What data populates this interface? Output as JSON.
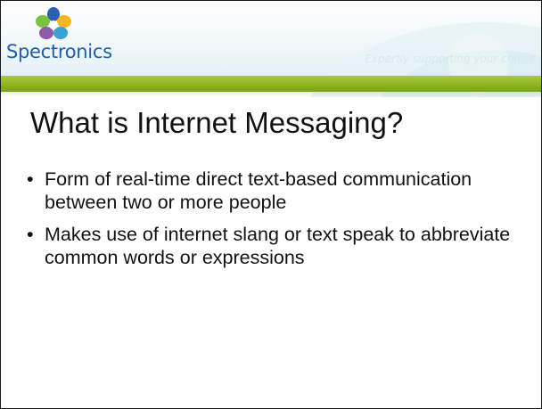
{
  "header": {
    "logo_text": "Spectronics",
    "tagline": "Expertly supporting your choice",
    "colors": {
      "accent_green": "#8db51f",
      "brand_blue": "#1f5fa8"
    }
  },
  "slide": {
    "title": "What is Internet Messaging?",
    "bullets": [
      {
        "text": "Form of real-time direct text-based communication between two or more people"
      },
      {
        "text": "Makes use of internet slang or text speak to abbreviate common words or expressions"
      }
    ]
  }
}
